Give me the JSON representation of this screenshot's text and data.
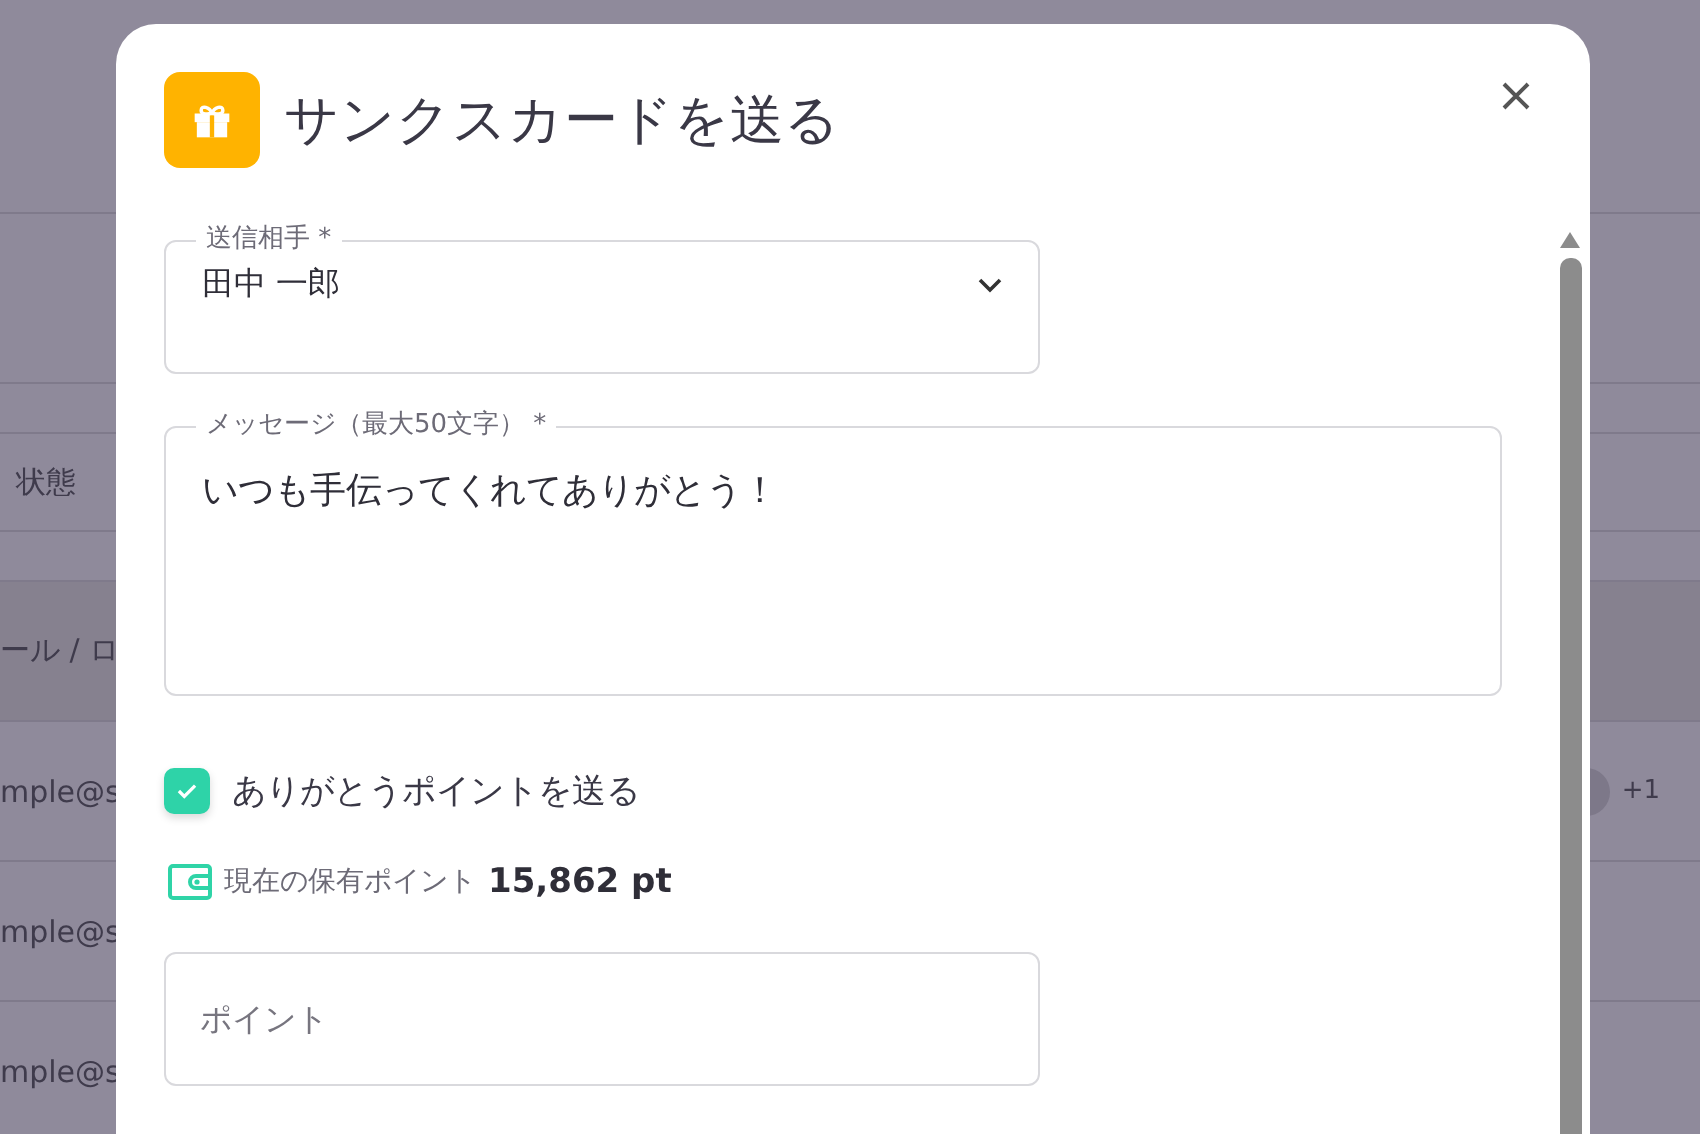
{
  "background_table": {
    "header": "状態",
    "rows": [
      "ール / ロ",
      "mple@s",
      "mple@s",
      "mple@s"
    ],
    "extra_count": "+1"
  },
  "dialog": {
    "title": "サンクスカードを送る",
    "recipient": {
      "label": "送信相手 *",
      "value": "田中 一郎"
    },
    "message": {
      "label": "メッセージ（最大50文字） *",
      "value": "いつも手伝ってくれてありがとう！"
    },
    "send_points": {
      "label": "ありがとうポイントを送る",
      "checked": true
    },
    "balance": {
      "label": "現在の保有ポイント",
      "value": "15,862 pt"
    },
    "points": {
      "placeholder": "ポイント"
    }
  }
}
